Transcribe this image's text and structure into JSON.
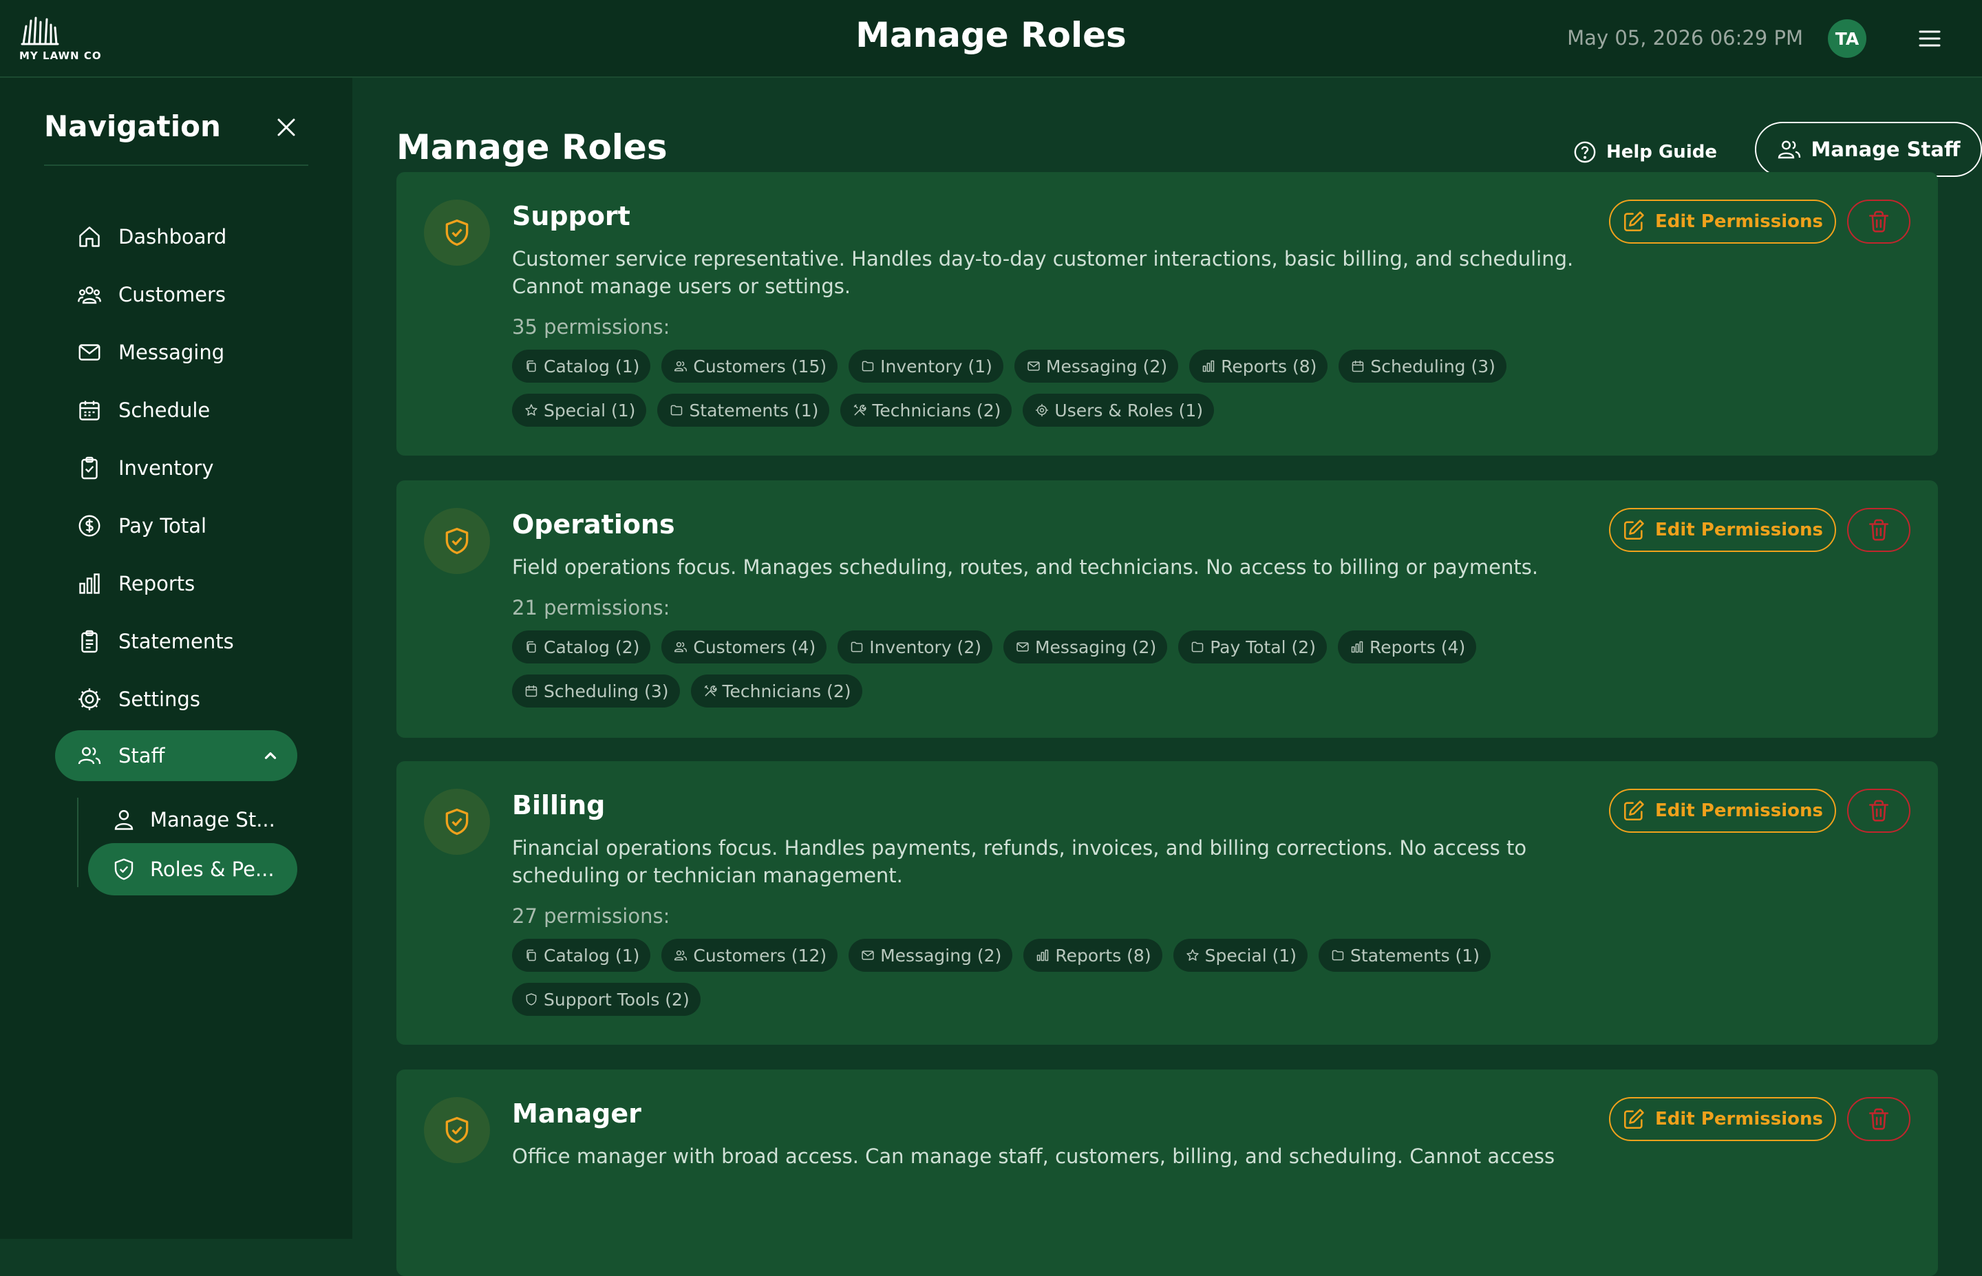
{
  "app": {
    "logo_text": "MY LAWN CO",
    "title": "Manage Roles",
    "datetime": "May 05, 2026 06:29 PM",
    "avatar_initials": "TA"
  },
  "sidebar": {
    "title": "Navigation",
    "items": [
      {
        "label": "Dashboard",
        "icon": "home-icon"
      },
      {
        "label": "Customers",
        "icon": "users-icon"
      },
      {
        "label": "Messaging",
        "icon": "mail-icon"
      },
      {
        "label": "Schedule",
        "icon": "calendar-icon"
      },
      {
        "label": "Inventory",
        "icon": "clipboard-check-icon"
      },
      {
        "label": "Pay Total",
        "icon": "dollar-circle-icon"
      },
      {
        "label": "Reports",
        "icon": "bar-chart-icon"
      },
      {
        "label": "Statements",
        "icon": "document-icon"
      },
      {
        "label": "Settings",
        "icon": "gear-icon"
      },
      {
        "label": "Staff",
        "icon": "users-icon"
      }
    ],
    "sub_items": [
      {
        "label": "Manage St...",
        "icon": "user-icon"
      },
      {
        "label": "Roles & Pe...",
        "icon": "shield-check-icon"
      }
    ]
  },
  "main": {
    "title": "Manage Roles",
    "help_label": "Help Guide",
    "manage_staff_label": "Manage Staff",
    "edit_label": "Edit Permissions"
  },
  "roles": [
    {
      "name": "Support",
      "description": "Customer service representative. Handles day-to-day customer interactions, basic billing, and scheduling. Cannot manage users or settings.",
      "count_label": "35 permissions:",
      "chips": [
        {
          "label": "Catalog (1)",
          "icon": "copy-icon"
        },
        {
          "label": "Customers (15)",
          "icon": "users-icon"
        },
        {
          "label": "Inventory (1)",
          "icon": "folder-icon"
        },
        {
          "label": "Messaging (2)",
          "icon": "mail-icon"
        },
        {
          "label": "Reports (8)",
          "icon": "bar-chart-icon"
        },
        {
          "label": "Scheduling (3)",
          "icon": "calendar-icon"
        },
        {
          "label": "Special (1)",
          "icon": "star-icon"
        },
        {
          "label": "Statements (1)",
          "icon": "folder-icon"
        },
        {
          "label": "Technicians (2)",
          "icon": "tools-icon"
        },
        {
          "label": "Users & Roles (1)",
          "icon": "user-cog-icon"
        }
      ]
    },
    {
      "name": "Operations",
      "description": "Field operations focus. Manages scheduling, routes, and technicians. No access to billing or payments.",
      "count_label": "21 permissions:",
      "chips": [
        {
          "label": "Catalog (2)",
          "icon": "copy-icon"
        },
        {
          "label": "Customers (4)",
          "icon": "users-icon"
        },
        {
          "label": "Inventory (2)",
          "icon": "folder-icon"
        },
        {
          "label": "Messaging (2)",
          "icon": "mail-icon"
        },
        {
          "label": "Pay Total (2)",
          "icon": "folder-icon"
        },
        {
          "label": "Reports (4)",
          "icon": "bar-chart-icon"
        },
        {
          "label": "Scheduling (3)",
          "icon": "calendar-icon"
        },
        {
          "label": "Technicians (2)",
          "icon": "tools-icon"
        }
      ]
    },
    {
      "name": "Billing",
      "description": "Financial operations focus. Handles payments, refunds, invoices, and billing corrections. No access to scheduling or technician management.",
      "count_label": "27 permissions:",
      "chips": [
        {
          "label": "Catalog (1)",
          "icon": "copy-icon"
        },
        {
          "label": "Customers (12)",
          "icon": "users-icon"
        },
        {
          "label": "Messaging (2)",
          "icon": "mail-icon"
        },
        {
          "label": "Reports (8)",
          "icon": "bar-chart-icon"
        },
        {
          "label": "Special (1)",
          "icon": "star-icon"
        },
        {
          "label": "Statements (1)",
          "icon": "folder-icon"
        },
        {
          "label": "Support Tools (2)",
          "icon": "shield-icon"
        }
      ]
    },
    {
      "name": "Manager",
      "description": "Office manager with broad access. Can manage staff, customers, billing, and scheduling. Cannot access",
      "count_label": "",
      "chips": []
    }
  ],
  "colors": {
    "background": "#0f3b25",
    "bar": "#0b2f1d",
    "card": "#17522f",
    "active": "#1c6d42",
    "accent": "#f0a11c",
    "danger": "#c0262d"
  }
}
